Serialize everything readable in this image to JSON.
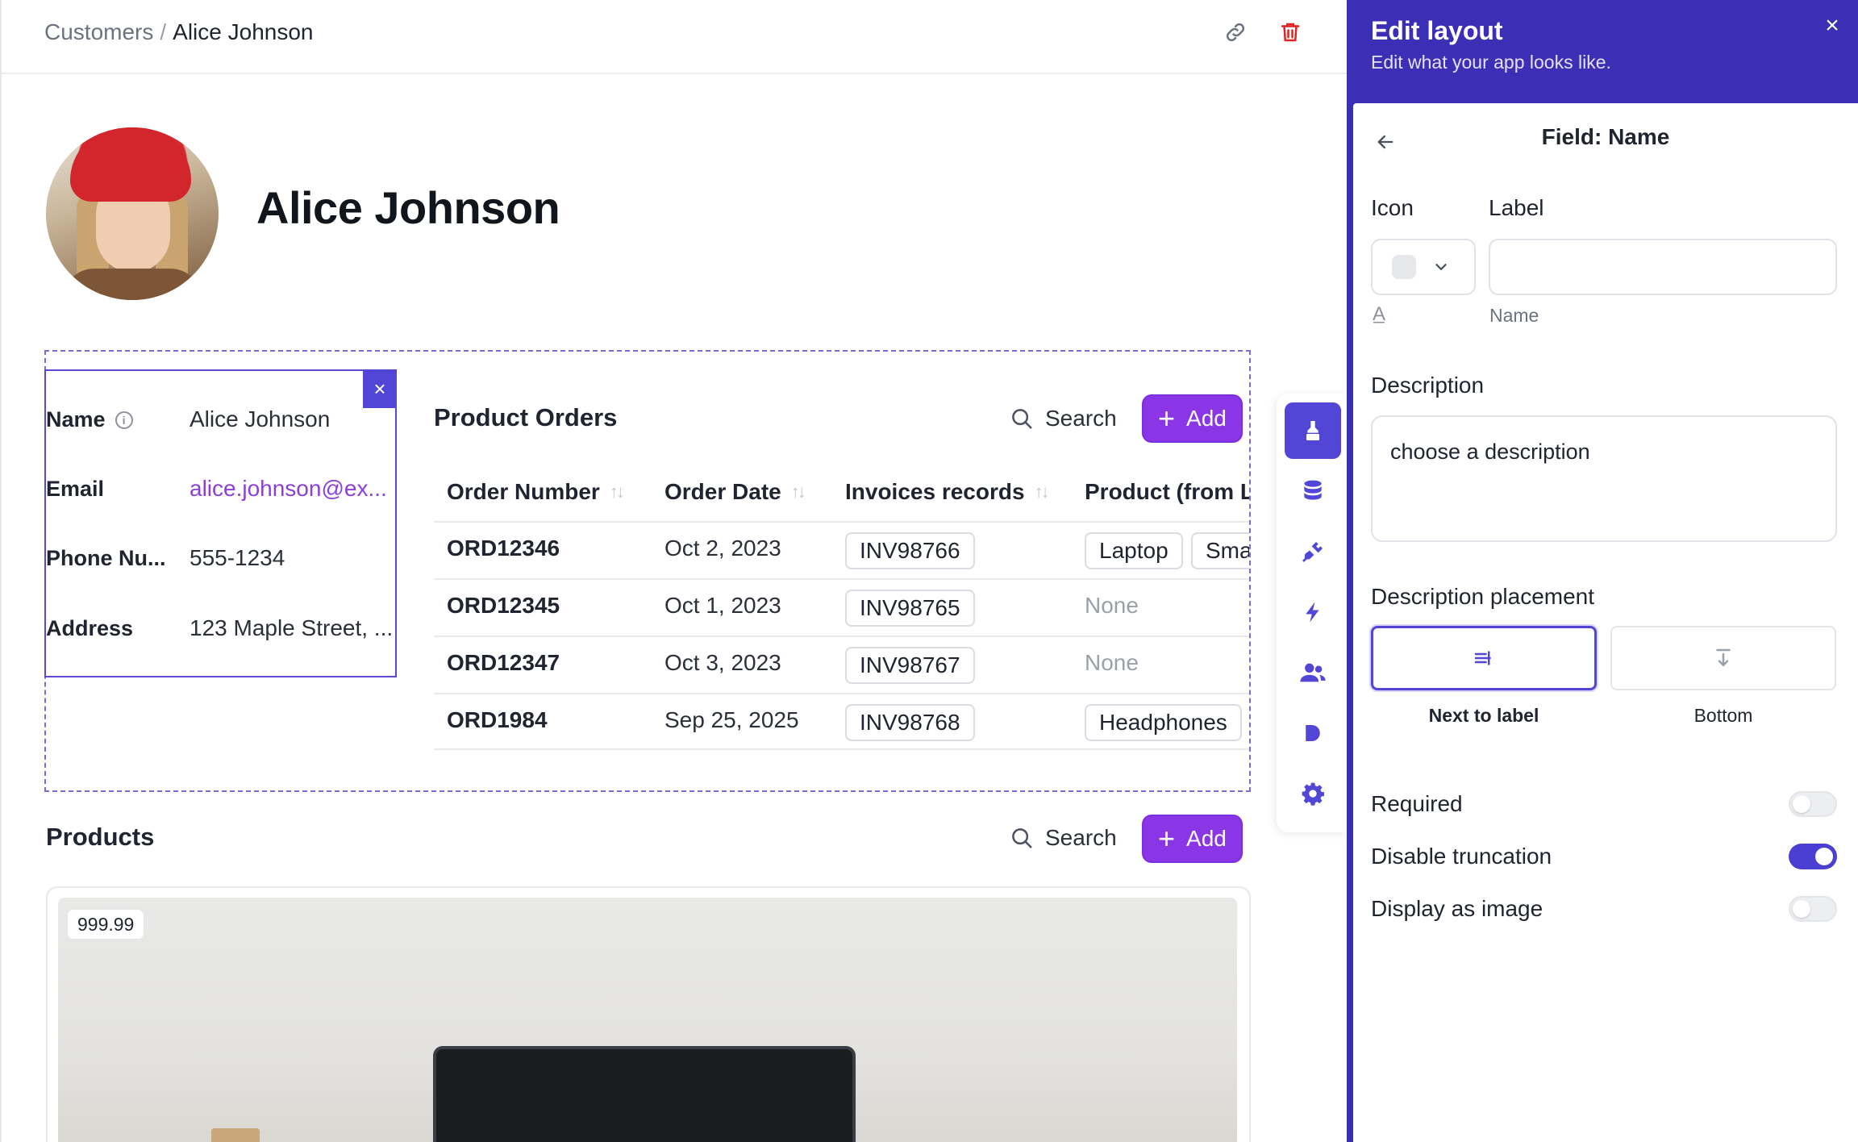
{
  "breadcrumb": {
    "parent": "Customers",
    "separator": "/",
    "current": "Alice Johnson"
  },
  "profile": {
    "name": "Alice Johnson"
  },
  "fields": [
    {
      "label": "Name",
      "value": "Alice Johnson"
    },
    {
      "label": "Email",
      "value": "alice.johnson@ex..."
    },
    {
      "label": "Phone Nu...",
      "value": "555-1234"
    },
    {
      "label": "Address",
      "value": "123 Maple Street, ..."
    }
  ],
  "orders": {
    "title": "Product Orders",
    "search_label": "Search",
    "add_label": "Add",
    "columns": [
      "Order Number",
      "Order Date",
      "Invoices records",
      "Product (from L"
    ],
    "rows": [
      {
        "order": "ORD12346",
        "date": "Oct 2, 2023",
        "invoice": "INV98766",
        "products": [
          "Laptop",
          "Sma"
        ]
      },
      {
        "order": "ORD12345",
        "date": "Oct 1, 2023",
        "invoice": "INV98765",
        "products_text": "None"
      },
      {
        "order": "ORD12347",
        "date": "Oct 3, 2023",
        "invoice": "INV98767",
        "products_text": "None"
      },
      {
        "order": "ORD1984",
        "date": "Sep 25, 2025",
        "invoice": "INV98768",
        "products": [
          "Headphones"
        ]
      }
    ]
  },
  "products": {
    "title": "Products",
    "search_label": "Search",
    "add_label": "Add",
    "price_badge": "999.99"
  },
  "rail": [
    "style-brush-icon",
    "database-icon",
    "plug-icon",
    "lightning-icon",
    "users-icon",
    "play-icon",
    "gear-icon"
  ],
  "panel": {
    "title": "Edit layout",
    "subtitle": "Edit what your app looks like.",
    "field_title": "Field: Name",
    "icon_label": "Icon",
    "label_label": "Label",
    "label_value": "",
    "label_hint": "Name",
    "description_label": "Description",
    "description_value": "choose a description",
    "placement_label": "Description placement",
    "placement_next": "Next to label",
    "placement_bottom": "Bottom",
    "toggles": [
      {
        "label": "Required",
        "on": false
      },
      {
        "label": "Disable truncation",
        "on": true
      },
      {
        "label": "Display as image",
        "on": false
      }
    ]
  },
  "colors": {
    "accent": "#5146d6",
    "add_button": "#8a35e6",
    "panel_header": "#3b30b5",
    "link": "#8b3fd8"
  }
}
